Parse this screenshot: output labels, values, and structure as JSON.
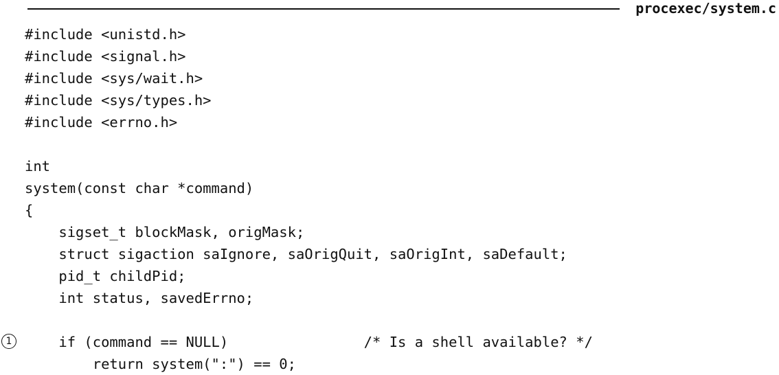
{
  "header": {
    "filename": "procexec/system.c"
  },
  "code": {
    "lines": [
      "#include <unistd.h>",
      "#include <signal.h>",
      "#include <sys/wait.h>",
      "#include <sys/types.h>",
      "#include <errno.h>",
      "",
      "int",
      "system(const char *command)",
      "{",
      "    sigset_t blockMask, origMask;",
      "    struct sigaction saIgnore, saOrigQuit, saOrigInt, saDefault;",
      "    pid_t childPid;",
      "    int status, savedErrno;",
      "",
      "    if (command == NULL)                /* Is a shell available? */",
      "        return system(\":\") == 0;"
    ]
  },
  "annotations": {
    "marker_1": "1"
  }
}
